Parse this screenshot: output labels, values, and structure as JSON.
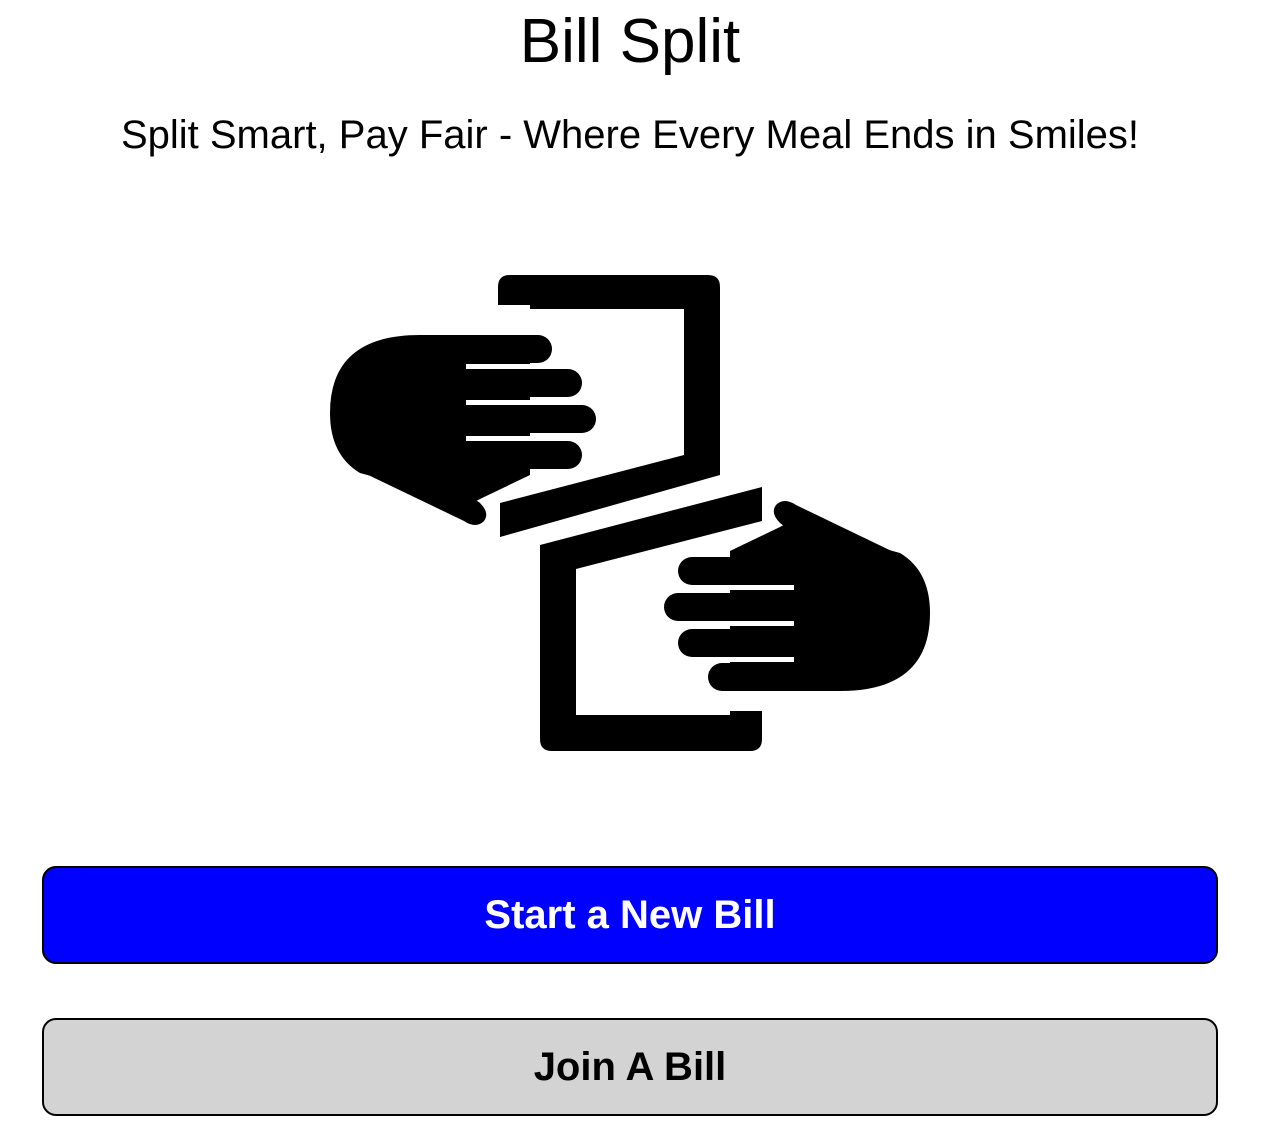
{
  "app": {
    "title": "Bill Split",
    "tagline": "Split Smart, Pay Fair - Where Every Meal Ends in Smiles!"
  },
  "logo": {
    "icon": "hands-exchanging-bill-icon"
  },
  "actions": {
    "start_label": "Start a New Bill",
    "join_label": "Join A Bill"
  },
  "colors": {
    "primary": "#0000ff",
    "secondary": "#d3d3d3",
    "text": "#000000",
    "background": "#ffffff"
  }
}
